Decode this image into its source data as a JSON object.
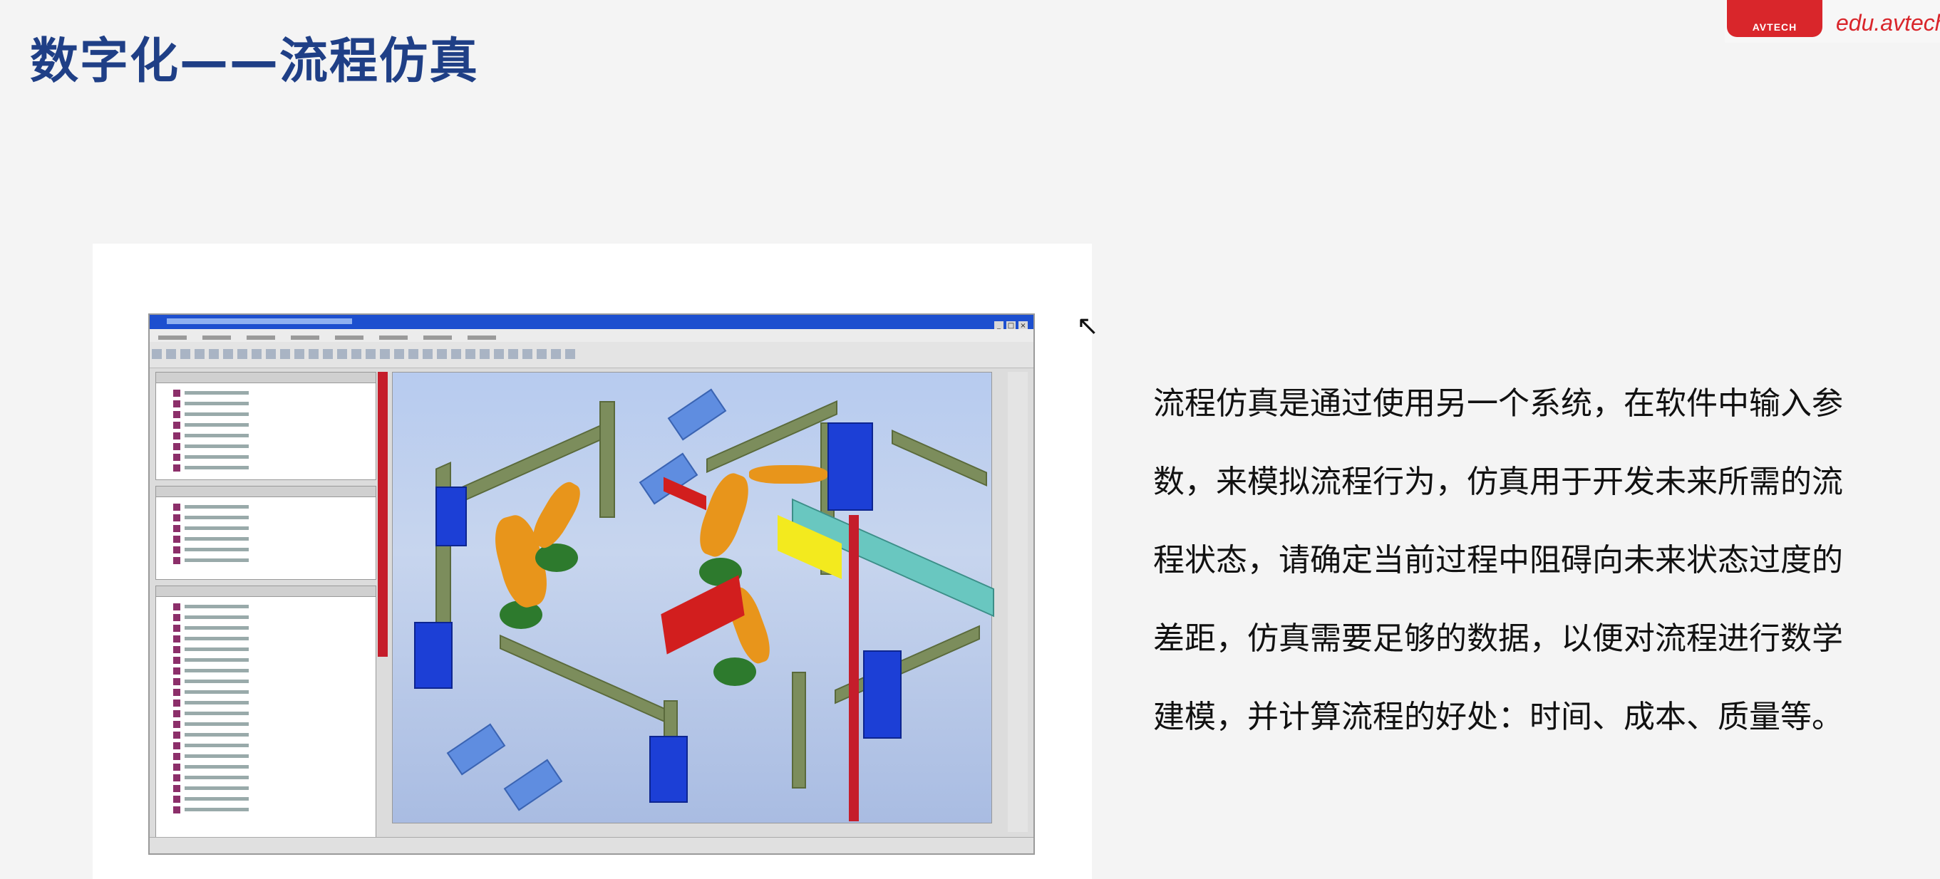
{
  "slide": {
    "title": "数字化——流程仿真",
    "logo": {
      "badge_text": "AVTECH",
      "url_text": "edu.avtech"
    },
    "description_lines": [
      "流程仿真是通过使用另一个系统，在软件中输入参",
      "数，来模拟流程行为，仿真用于开发未来所需的流",
      "程状态，请确定当前过程中阻碍向未来状态过度的",
      "差距，仿真需要足够的数据，以便对流程进行数学",
      "建模，并计算流程的好处：时间、成本、质量等。"
    ],
    "cursor_icon": "pointer-arrow-icon",
    "window_buttons": [
      "_",
      "□",
      "×"
    ]
  },
  "colors": {
    "title": "#1f3f86",
    "logo_red": "#d9262b",
    "text": "#111111"
  }
}
